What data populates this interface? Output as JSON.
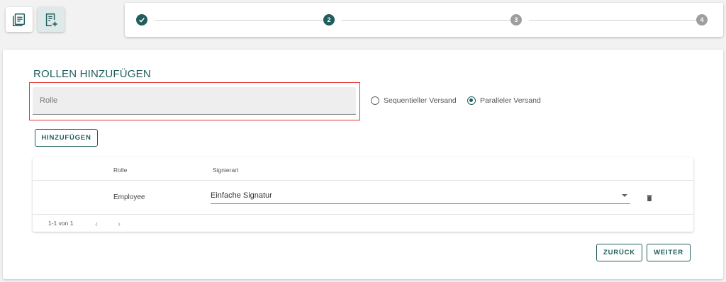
{
  "toolbar": {
    "list_icon": "document-list-icon",
    "add_icon": "document-add-icon"
  },
  "stepper": {
    "steps": [
      {
        "label": "",
        "state": "done",
        "icon": "check-icon"
      },
      {
        "label": "2",
        "state": "current"
      },
      {
        "label": "3",
        "state": "todo"
      },
      {
        "label": "4",
        "state": "todo"
      }
    ],
    "colors": {
      "active": "#1f5e5c",
      "inactive": "#9e9e9e"
    }
  },
  "form": {
    "title": "ROLLEN HINZUFÜGEN",
    "role_placeholder": "Rolle",
    "role_value": "",
    "radio_sequential": "Sequentieller Versand",
    "radio_parallel": "Paralleler Versand",
    "selected_mode": "parallel",
    "add_button": "HINZUFÜGEN"
  },
  "table": {
    "headers": {
      "role": "Rolle",
      "signature_type": "Signierart"
    },
    "rows": [
      {
        "role": "Employee",
        "signature_type": "Einfache Signatur"
      }
    ],
    "pagination": "1-1 von 1",
    "prev_icon": "chevron-left-icon",
    "next_icon": "chevron-right-icon",
    "delete_icon": "trash-icon"
  },
  "nav": {
    "back_button": "ZURÜCK",
    "next_button": "WEITER"
  },
  "colors": {
    "accent": "#1f5e5c",
    "highlight": "#e53935"
  }
}
